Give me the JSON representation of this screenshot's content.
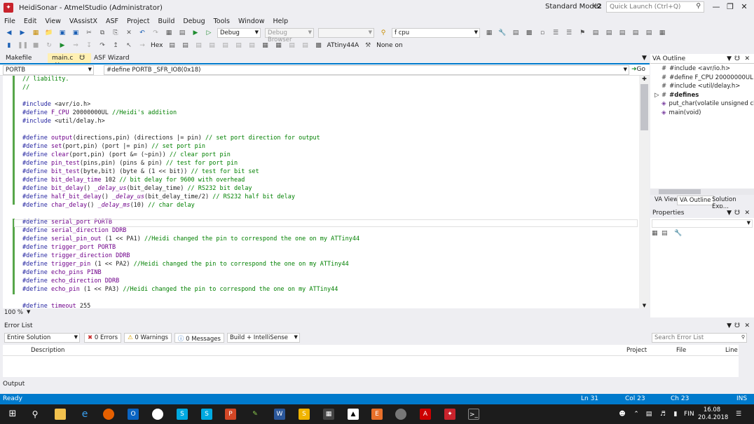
{
  "window": {
    "title": "HeidiSonar - AtmelStudio (Administrator)",
    "mode": "Standard Mode",
    "mode_badge": "☇2",
    "quick_launch_placeholder": "Quick Launch (Ctrl+Q)"
  },
  "menu": [
    "File",
    "Edit",
    "View",
    "VAssistX",
    "ASF",
    "Project",
    "Build",
    "Debug",
    "Tools",
    "Window",
    "Help"
  ],
  "toolbar": {
    "config": "Debug",
    "debug_browser": "Debug Browser",
    "find_value": "f cpu",
    "hex_label": "Hex",
    "device": "ATtiny44A",
    "tool": "None on"
  },
  "tabs": {
    "makefile": "Makefile",
    "main": "main.c",
    "asf": "ASF Wizard"
  },
  "nav": {
    "scope": "PORTB",
    "definition": "#define PORTB _SFR_IO8(0x18)",
    "go": "Go"
  },
  "editor": {
    "zoom": "100 %",
    "cursor_line_index": 17
  },
  "code_lines": [
    {
      "t": "// liability.",
      "c": "cm"
    },
    {
      "t": "//",
      "c": "cm"
    },
    {
      "t": "",
      "c": ""
    },
    {
      "parts": [
        [
          "#include ",
          "pp"
        ],
        [
          "<avr/io.h>",
          ""
        ]
      ]
    },
    {
      "parts": [
        [
          "#define ",
          "pp"
        ],
        [
          "F_CPU ",
          "mac"
        ],
        [
          "20000000UL ",
          ""
        ],
        [
          "//Heidi's addition",
          "cm"
        ]
      ]
    },
    {
      "parts": [
        [
          "#include ",
          "pp"
        ],
        [
          "<util/delay.h>",
          ""
        ]
      ]
    },
    {
      "t": "",
      "c": ""
    },
    {
      "parts": [
        [
          "#define ",
          "pp"
        ],
        [
          "output",
          "mac"
        ],
        [
          "(directions,pin) (directions |= pin) ",
          ""
        ],
        [
          "// set port direction for output",
          "cm"
        ]
      ]
    },
    {
      "parts": [
        [
          "#define ",
          "pp"
        ],
        [
          "set",
          "mac"
        ],
        [
          "(port,pin) (port |= pin) ",
          ""
        ],
        [
          "// set port pin",
          "cm"
        ]
      ]
    },
    {
      "parts": [
        [
          "#define ",
          "pp"
        ],
        [
          "clear",
          "mac"
        ],
        [
          "(port,pin) (port &= (~pin)) ",
          ""
        ],
        [
          "// clear port pin",
          "cm"
        ]
      ]
    },
    {
      "parts": [
        [
          "#define ",
          "pp"
        ],
        [
          "pin_test",
          "mac"
        ],
        [
          "(pins,pin) (pins & pin) ",
          ""
        ],
        [
          "// test for port pin",
          "cm"
        ]
      ]
    },
    {
      "parts": [
        [
          "#define ",
          "pp"
        ],
        [
          "bit_test",
          "mac"
        ],
        [
          "(byte,bit) (byte & (1 << bit)) ",
          ""
        ],
        [
          "// test for bit set",
          "cm"
        ]
      ]
    },
    {
      "parts": [
        [
          "#define ",
          "pp"
        ],
        [
          "bit_delay_time ",
          "mac"
        ],
        [
          "102 ",
          ""
        ],
        [
          "// bit delay for 9600 with overhead",
          "cm"
        ]
      ]
    },
    {
      "parts": [
        [
          "#define ",
          "pp"
        ],
        [
          "bit_delay",
          "mac"
        ],
        [
          "() ",
          ""
        ],
        [
          "_delay_us",
          "fn"
        ],
        [
          "(bit_delay_time) ",
          ""
        ],
        [
          "// RS232 bit delay",
          "cm"
        ]
      ]
    },
    {
      "parts": [
        [
          "#define ",
          "pp"
        ],
        [
          "half_bit_delay",
          "mac"
        ],
        [
          "() ",
          ""
        ],
        [
          "_delay_us",
          "fn"
        ],
        [
          "(bit_delay_time/2) ",
          ""
        ],
        [
          "// RS232 half bit delay",
          "cm"
        ]
      ]
    },
    {
      "parts": [
        [
          "#define ",
          "pp"
        ],
        [
          "char_delay",
          "mac"
        ],
        [
          "() ",
          ""
        ],
        [
          "_delay_ms",
          "fn"
        ],
        [
          "(10) ",
          ""
        ],
        [
          "// char delay",
          "cm"
        ]
      ]
    },
    {
      "t": "",
      "c": ""
    },
    {
      "parts": [
        [
          "#define ",
          "pp"
        ],
        [
          "serial_port ",
          "mac"
        ],
        [
          "PORTB",
          "mac"
        ]
      ]
    },
    {
      "parts": [
        [
          "#define ",
          "pp"
        ],
        [
          "serial_direction ",
          "mac"
        ],
        [
          "DDRB",
          "mac"
        ]
      ]
    },
    {
      "parts": [
        [
          "#define ",
          "pp"
        ],
        [
          "serial_pin_out ",
          "mac"
        ],
        [
          "(1 << PA1) ",
          ""
        ],
        [
          "//Heidi changed the pin to correspond the one on my ATTiny44",
          "cm"
        ]
      ]
    },
    {
      "parts": [
        [
          "#define ",
          "pp"
        ],
        [
          "trigger_port ",
          "mac"
        ],
        [
          "PORTB",
          "mac"
        ]
      ]
    },
    {
      "parts": [
        [
          "#define ",
          "pp"
        ],
        [
          "trigger_direction ",
          "mac"
        ],
        [
          "DDRB",
          "mac"
        ]
      ]
    },
    {
      "parts": [
        [
          "#define ",
          "pp"
        ],
        [
          "trigger_pin ",
          "mac"
        ],
        [
          "(1 << PA2) ",
          ""
        ],
        [
          "//Heidi changed the pin to correspond the one on my ATTiny44",
          "cm"
        ]
      ]
    },
    {
      "parts": [
        [
          "#define ",
          "pp"
        ],
        [
          "echo_pins ",
          "mac"
        ],
        [
          "PINB",
          "mac"
        ]
      ]
    },
    {
      "parts": [
        [
          "#define ",
          "pp"
        ],
        [
          "echo_direction ",
          "mac"
        ],
        [
          "DDRB",
          "mac"
        ]
      ]
    },
    {
      "parts": [
        [
          "#define ",
          "pp"
        ],
        [
          "echo_pin ",
          "mac"
        ],
        [
          "(1 << PA3) ",
          ""
        ],
        [
          "//Heidi changed the pin to correspond the one on my ATTiny44",
          "cm"
        ]
      ]
    },
    {
      "t": "",
      "c": ""
    },
    {
      "parts": [
        [
          "#define ",
          "pp"
        ],
        [
          "timeout ",
          "mac"
        ],
        [
          "255",
          ""
        ]
      ]
    }
  ],
  "va_outline": {
    "title": "VA Outline",
    "items": [
      {
        "label": "#include <avr/io.h>",
        "bold": false,
        "expander": false
      },
      {
        "label": "#define F_CPU 20000000UL //H",
        "bold": false,
        "expander": false
      },
      {
        "label": "#include <util/delay.h>",
        "bold": false,
        "expander": false
      },
      {
        "label": "#defines",
        "bold": true,
        "expander": true
      },
      {
        "label": "put_char(volatile unsigned char",
        "bold": false,
        "expander": false
      },
      {
        "label": "main(void)",
        "bold": false,
        "expander": false
      }
    ],
    "tabs": [
      "VA View",
      "VA Outline",
      "Solution Exp..."
    ]
  },
  "properties": {
    "title": "Properties"
  },
  "error_list": {
    "title": "Error List",
    "scope": "Entire Solution",
    "errors": "0 Errors",
    "warnings": "0 Warnings",
    "messages": "0 Messages",
    "build": "Build + IntelliSense",
    "search_placeholder": "Search Error List",
    "columns": [
      "Description",
      "Project",
      "File",
      "Line"
    ]
  },
  "output_tab": "Output",
  "status": {
    "ready": "Ready",
    "ln": "Ln 31",
    "col": "Col 23",
    "ch": "Ch 23",
    "ins": "INS"
  },
  "taskbar": {
    "time": "16.08",
    "date": "20.4.2018",
    "lang": "FIN"
  },
  "colors": {
    "accent": "#007acc",
    "active_tab": "#fff0b3",
    "taskbar": "#1c1c1c"
  }
}
